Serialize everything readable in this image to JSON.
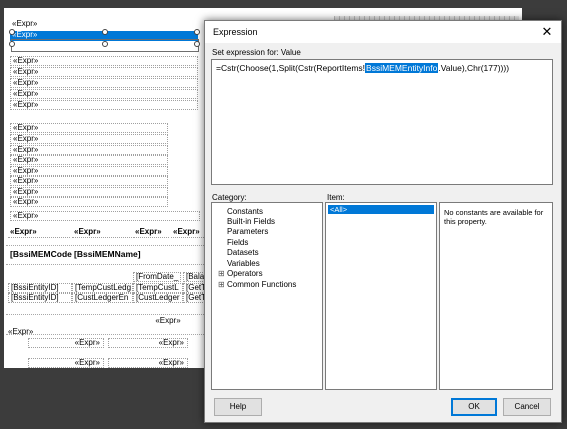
{
  "report": {
    "expr_label": "«Expr»",
    "selected_label": "«Expr»",
    "header_cols": [
      "«Expr»",
      "«Expr»",
      "«Expr»",
      "«Expr»"
    ],
    "table_headers": [
      "[BssiMEMCode",
      "[BssiMEMName]"
    ],
    "row_fromdate": [
      "[FromDate_",
      "[Bala"
    ],
    "row1": [
      "[BssiEntityID]",
      "[TempCustLedg",
      "[TempCustL",
      "[GetT"
    ],
    "row2": [
      "[BssiEntityID]",
      "[CustLedgerEn",
      "[CustLedger",
      "[GetT"
    ]
  },
  "dialog": {
    "title": "Expression",
    "close_label": "✕",
    "set_expression_label": "Set expression for: Value",
    "expression_before": "=Cstr(Choose(1,Split(Cstr(ReportItems!",
    "expression_selected": "BssiMEMEntityInfo",
    "expression_after": ".Value),Chr(177))))",
    "category_label": "Category:",
    "item_label": "Item:",
    "categories": [
      {
        "label": "Constants",
        "expander": ""
      },
      {
        "label": "Built-in Fields",
        "expander": ""
      },
      {
        "label": "Parameters",
        "expander": ""
      },
      {
        "label": "Fields",
        "expander": ""
      },
      {
        "label": "Datasets",
        "expander": ""
      },
      {
        "label": "Variables",
        "expander": ""
      },
      {
        "label": "Operators",
        "expander": "⊞"
      },
      {
        "label": "Common Functions",
        "expander": "⊞"
      }
    ],
    "items": [
      "<All>"
    ],
    "description": "No constants are available for this property.",
    "help_button": "Help",
    "ok_button": "OK",
    "cancel_button": "Cancel"
  },
  "colors": {
    "accent": "#0078d7",
    "background": "#3c3c3c",
    "dialog": "#f0f0f0"
  }
}
